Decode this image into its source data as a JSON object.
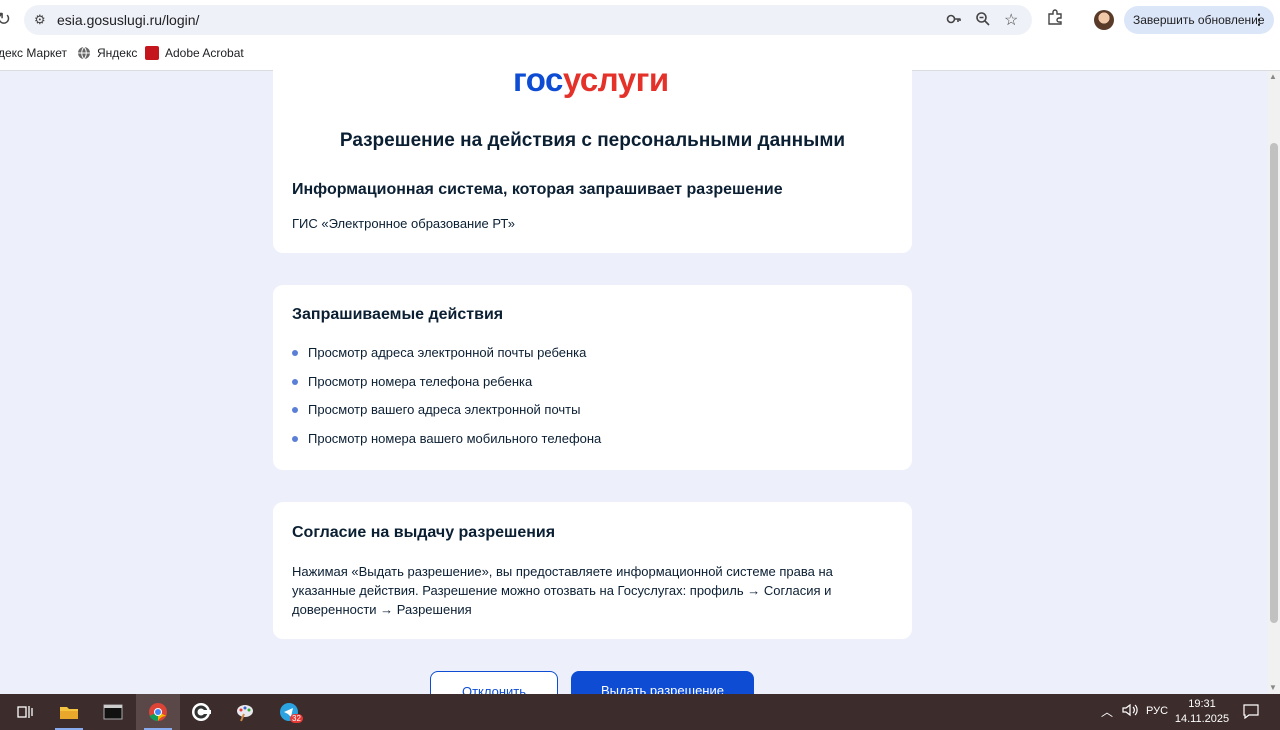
{
  "browser": {
    "url": "esia.gosuslugi.ru/login/",
    "update_button": "Завершить обновление",
    "bookmarks": [
      {
        "label": "декс Маркет",
        "icon": "yandex-market-icon"
      },
      {
        "label": "Яндекс",
        "icon": "globe-icon"
      },
      {
        "label": "Adobe Acrobat",
        "icon": "adobe-acrobat-icon"
      }
    ]
  },
  "logo": {
    "part1": "гос",
    "part2": "услуги"
  },
  "page": {
    "title": "Разрешение на действия с персональными данными",
    "system": {
      "heading": "Информационная система, которая запрашивает разрешение",
      "name": "ГИС «Электронное образование РТ»"
    },
    "actions": {
      "heading": "Запрашиваемые действия",
      "items": [
        "Просмотр адреса электронной почты ребенка",
        "Просмотр номера телефона ребенка",
        "Просмотр вашего адреса электронной почты",
        "Просмотр номера вашего мобильного телефона"
      ]
    },
    "consent": {
      "heading": "Согласие на выдачу разрешения",
      "text": "Нажимая «Выдать разрешение», вы предоставляете информационной системе права на указанные действия. Разрешение можно отозвать на Госуслугах: профиль → Согласия и доверенности → Разрешения"
    },
    "buttons": {
      "decline": "Отклонить",
      "grant": "Выдать разрешение"
    }
  },
  "taskbar": {
    "language": "РУС",
    "time": "19:31",
    "date": "14.11.2025",
    "telegram_badge": "32"
  },
  "colors": {
    "accent": "#0d4cd3",
    "logo_red": "#e4322b",
    "background": "#edf0fb"
  }
}
